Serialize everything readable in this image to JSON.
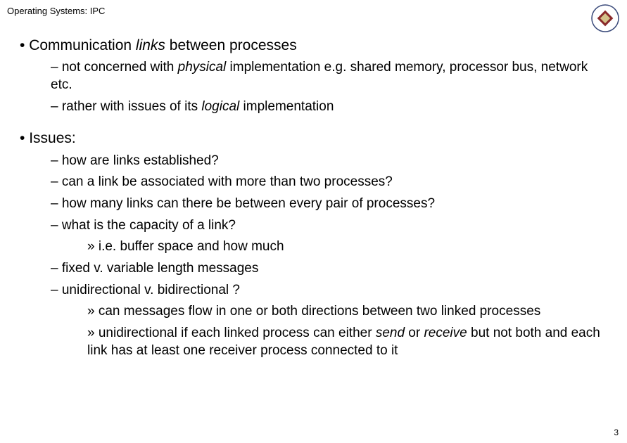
{
  "header": "Operating Systems: IPC",
  "page_number": "3",
  "bullets": {
    "b1": {
      "pre": "Communication ",
      "em": "links",
      "post": " between processes"
    },
    "b1_1": {
      "pre": "not concerned with ",
      "em": "physical",
      "post": " implementation e.g. shared memory, processor bus, network etc."
    },
    "b1_2": {
      "pre": "rather with issues of its ",
      "em": "logical",
      "post": " implementation"
    },
    "b2": "Issues:",
    "b2_1": "how are links established?",
    "b2_2": "can a link be associated with more than two processes?",
    "b2_3": "how many links can there be between every pair of processes?",
    "b2_4": "what is the capacity of a link?",
    "b2_4_1": "i.e. buffer space and how much",
    "b2_5": "fixed v. variable length messages",
    "b2_6": "unidirectional v. bidirectional ?",
    "b2_6_1": "can messages flow in one or both directions between two linked processes",
    "b2_6_2": {
      "pre": "unidirectional if each linked process can either ",
      "em1": "send",
      "mid": " or ",
      "em2": "receive",
      "post": " but not both and each link has at least one receiver process connected to it"
    }
  }
}
